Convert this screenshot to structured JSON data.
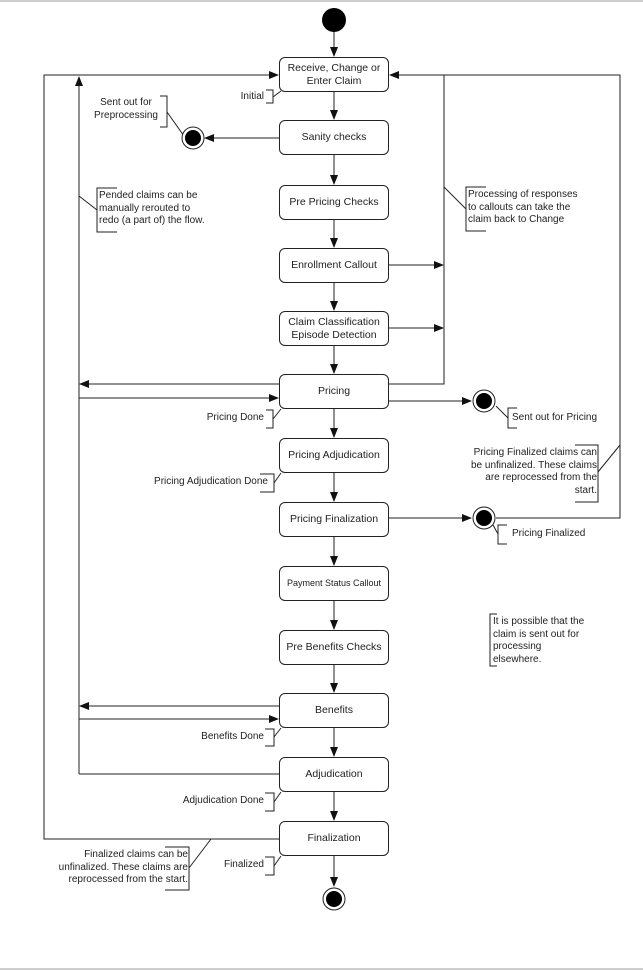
{
  "diagram": {
    "type": "uml-state-diagram",
    "states": [
      {
        "id": "receive",
        "label": "Receive, Change or Enter Claim"
      },
      {
        "id": "sanity",
        "label": "Sanity checks"
      },
      {
        "id": "prepricing",
        "label": "Pre Pricing Checks"
      },
      {
        "id": "enrollment",
        "label": "Enrollment Callout"
      },
      {
        "id": "classification",
        "label": "Claim Classification Episode Detection"
      },
      {
        "id": "pricing",
        "label": "Pricing"
      },
      {
        "id": "pricingadj",
        "label": "Pricing Adjudication"
      },
      {
        "id": "pricingfin",
        "label": "Pricing Finalization"
      },
      {
        "id": "payment",
        "label": "Payment Status Callout"
      },
      {
        "id": "prebenefits",
        "label": "Pre Benefits Checks"
      },
      {
        "id": "benefits",
        "label": "Benefits"
      },
      {
        "id": "adjudication",
        "label": "Adjudication"
      },
      {
        "id": "finalization",
        "label": "Finalization"
      }
    ],
    "status_labels": {
      "initial": "Initial",
      "pricing_done": "Pricing Done",
      "pricing_adj_done": "Pricing Adjudication Done",
      "benefits_done": "Benefits Done",
      "adjudication_done": "Adjudication Done",
      "finalized": "Finalized",
      "sent_out_preprocessing": "Sent out for\nPreprocessing",
      "sent_out_pricing": "Sent out for Pricing",
      "pricing_finalized": "Pricing Finalized"
    },
    "notes": {
      "pended": "Pended claims can be\nmanually rerouted to\nredo (a part of) the flow.",
      "callouts": "Processing of responses\nto callouts can take the\nclaim back to Change",
      "pricing_unfinalize": "Pricing Finalized claims can\nbe unfinalized. These claims\nare reprocessed from the\nstart.",
      "elsewhere": "It is possible that the\nclaim is sent out for\nprocessing\nelsewhere.",
      "finalized_unfinalize": "Finalized claims can be\nunfinalized. These claims are\nreprocessed from the start."
    },
    "colors": {
      "line": "#222222",
      "fill": "#000000",
      "background": "#ffffff"
    }
  }
}
